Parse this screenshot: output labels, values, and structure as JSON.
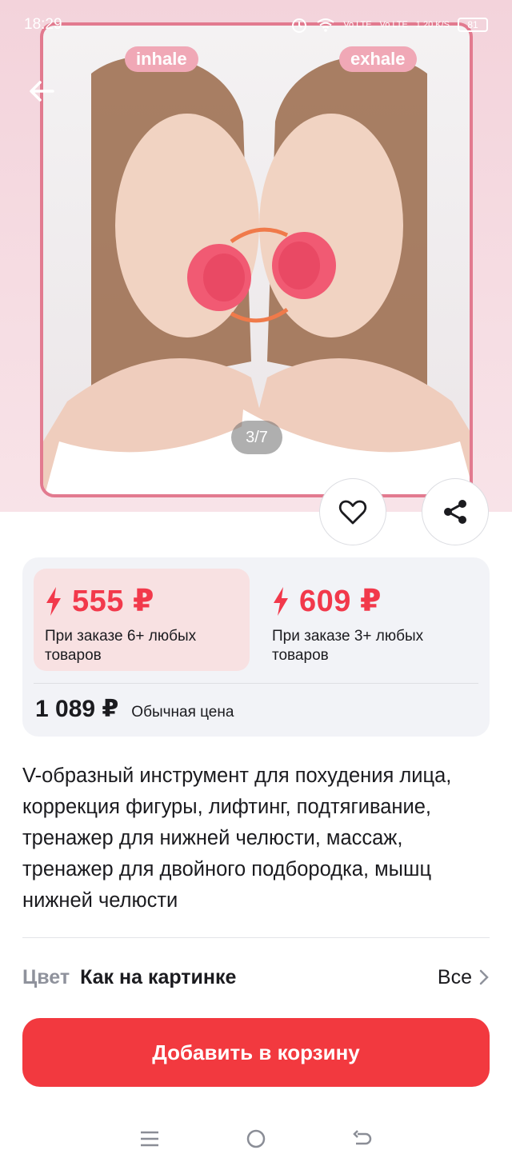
{
  "status_bar": {
    "time": "18:29",
    "network1": "Vo LTE",
    "network2": "Vo LTE",
    "speed": "1.20 K/S",
    "battery": "81"
  },
  "gallery": {
    "label_left": "inhale",
    "label_right": "exhale",
    "counter": "3/7"
  },
  "prices": {
    "tier1": {
      "price": "555 ₽",
      "note": "При заказе 6+ любых товаров"
    },
    "tier2": {
      "price": "609 ₽",
      "note": "При заказе 3+ любых товаров"
    },
    "regular_price": "1 089 ₽",
    "regular_label": "Обычная цена"
  },
  "product": {
    "title": "V-образный инструмент для похудения лица, коррекция фигуры, лифтинг, подтягивание, тренажер для нижней челюсти, массаж, тренажер для двойного подбородка, мышц нижней челюсти"
  },
  "variant": {
    "label": "Цвет",
    "value": "Как на картинке",
    "all_link": "Все"
  },
  "cta": {
    "label": "Добавить в корзину"
  },
  "colors": {
    "accent": "#f2394b",
    "cta": "#f2393f",
    "tier_bg": "#f8e1e2",
    "card_bg": "#f2f3f7"
  },
  "icons": [
    "back-arrow-icon",
    "heart-icon",
    "share-icon",
    "lightning-icon",
    "chevron-right-icon",
    "menu-icon",
    "home-circle-icon",
    "back-nav-icon"
  ]
}
